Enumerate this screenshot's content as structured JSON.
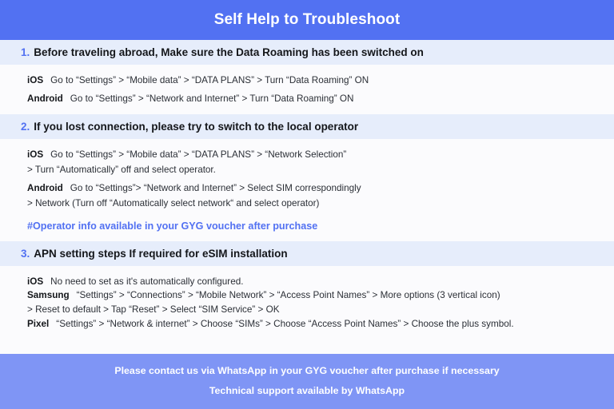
{
  "header": {
    "title": "Self Help to Troubleshoot"
  },
  "sections": [
    {
      "number": "1.",
      "title": "Before traveling abroad, Make sure the Data Roaming has been switched on",
      "rows": [
        {
          "platform": "iOS",
          "steps": "Go to “Settings” > “Mobile data” > “DATA PLANS” > Turn “Data Roaming” ON"
        },
        {
          "platform": "Android",
          "steps": "Go to “Settings” > “Network and Internet” > Turn “Data Roaming” ON"
        }
      ]
    },
    {
      "number": "2.",
      "title": "If you lost connection, please try to switch to the local operator",
      "rows": [
        {
          "platform": "iOS",
          "steps": "Go to “Settings” > “Mobile data” > “DATA PLANS” > “Network Selection”"
        },
        {
          "platform": "",
          "steps": "> Turn “Automatically” off and select operator."
        },
        {
          "platform": "Android",
          "steps": "Go to “Settings”>  “Network and Internet” > Select SIM correspondingly"
        },
        {
          "platform": "",
          "steps": "> Network (Turn off “Automatically select network“ and select operator)"
        }
      ],
      "note": "#Operator info available in your GYG voucher after purchase"
    },
    {
      "number": "3.",
      "title": "APN setting steps If required for eSIM installation",
      "rows": [
        {
          "platform": "iOS",
          "steps": "No need to set as it's automatically configured."
        },
        {
          "platform": "Samsung",
          "steps": "“Settings” > “Connections” > “Mobile Network” > “Access Point Names” > More options (3 vertical icon)"
        },
        {
          "platform": "",
          "steps": "> Reset to default > Tap “Reset” > Select “SIM Service” > OK"
        },
        {
          "platform": "Pixel",
          "steps": "“Settings” > “Network & internet” > Choose “SIMs” > Choose “Access Point Names” > Choose the plus symbol."
        }
      ]
    }
  ],
  "footer": {
    "line1": "Please contact us via WhatsApp  in your GYG voucher after purchase if necessary",
    "line2": "Technical support available by WhatsApp"
  },
  "colors": {
    "header_blue": "#5271f2",
    "footer_blue": "#7f95f5",
    "band_blue": "#e6edfb",
    "accent": "#5271f2",
    "page_bg": "#fbfbfd",
    "body_text": "#2b2f36"
  }
}
